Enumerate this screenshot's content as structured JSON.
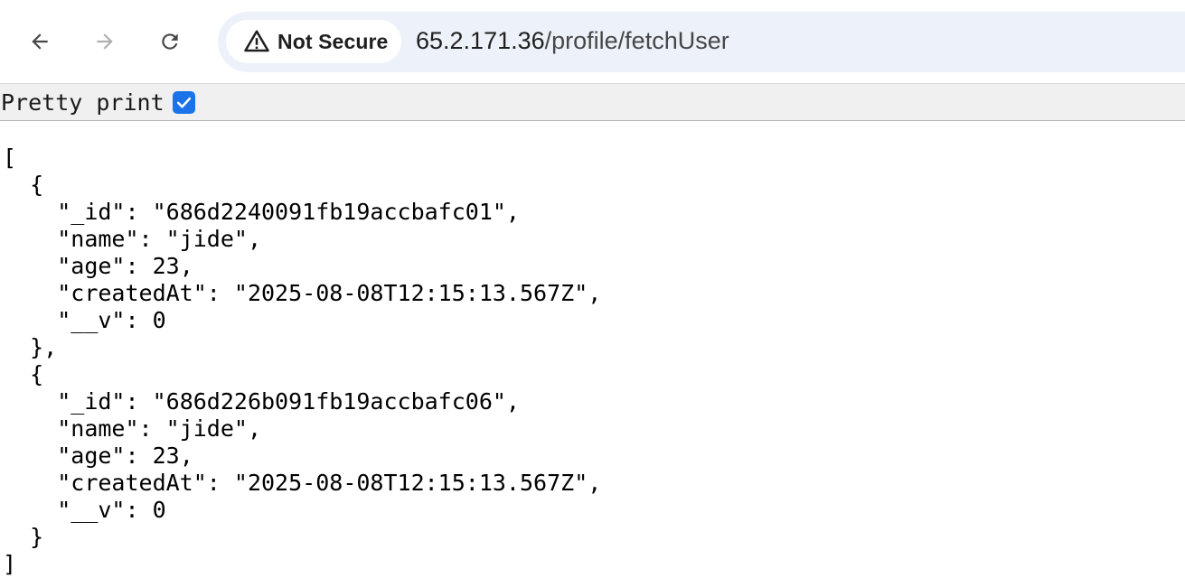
{
  "browser": {
    "security_label": "Not Secure",
    "url_host": "65.2.171.36",
    "url_path": "/profile/fetchUser",
    "icons": {
      "back": "arrow-left-icon",
      "forward": "arrow-right-icon",
      "reload": "reload-icon",
      "security": "warning-triangle-icon"
    }
  },
  "pretty_print": {
    "label": "Pretty print",
    "checked": true
  },
  "json_lines": {
    "open_array": "[",
    "r0_open": "{",
    "r0_id_key": "\"_id\"",
    "r0_id_sep": ": ",
    "r0_id_val": "\"686d2240091fb19accbafc01\",",
    "r0_name_key": "\"name\"",
    "r0_name_sep": ": ",
    "r0_name_val": "\"jide\",",
    "r0_age_key": "\"age\"",
    "r0_age_sep": ": ",
    "r0_age_val": "23,",
    "r0_created_key": "\"createdAt\"",
    "r0_created_sep": ": ",
    "r0_created_val": "\"2025-08-08T12:15:13.567Z\",",
    "r0_v_key": "\"__v\"",
    "r0_v_sep": ": ",
    "r0_v_val": "0",
    "r0_close": "},",
    "r1_open": "{",
    "r1_id_key": "\"_id\"",
    "r1_id_sep": ": ",
    "r1_id_val": "\"686d226b091fb19accbafc06\",",
    "r1_name_key": "\"name\"",
    "r1_name_sep": ": ",
    "r1_name_val": "\"jide\",",
    "r1_age_key": "\"age\"",
    "r1_age_sep": ": ",
    "r1_age_val": "23,",
    "r1_created_key": "\"createdAt\"",
    "r1_created_sep": ": ",
    "r1_created_val": "\"2025-08-08T12:15:13.567Z\",",
    "r1_v_key": "\"__v\"",
    "r1_v_sep": ": ",
    "r1_v_val": "0",
    "r1_close": "}",
    "close_array": "]"
  }
}
